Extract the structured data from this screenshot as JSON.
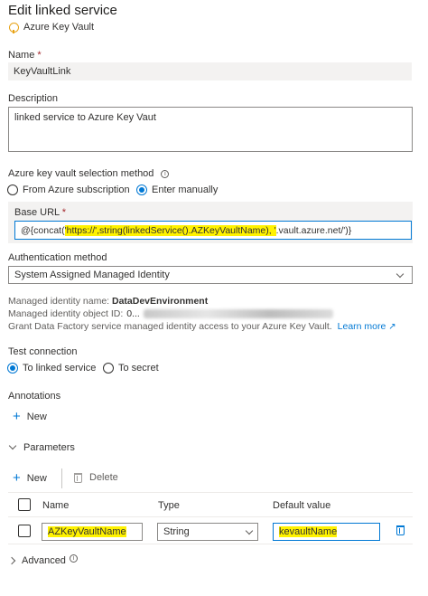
{
  "header": {
    "title": "Edit linked service",
    "subtitle": "Azure Key Vault"
  },
  "name": {
    "label": "Name",
    "required": "*",
    "value": "KeyVaultLink"
  },
  "description": {
    "label": "Description",
    "value": "linked service to Azure Key Vaut"
  },
  "selection_method": {
    "label": "Azure key vault selection method",
    "options": [
      "From Azure subscription",
      "Enter manually"
    ],
    "selected": "Enter manually"
  },
  "base_url": {
    "label": "Base URL",
    "required": "*",
    "value_prefix": "@{concat(",
    "value_highlight": "'https://',string(linkedService().AZKeyVaultName), '",
    "value_suffix": ".vault.azure.net/')}"
  },
  "auth": {
    "label": "Authentication method",
    "value": "System Assigned Managed Identity"
  },
  "managed_identity": {
    "name_label": "Managed identity name:",
    "name_value": "DataDevEnvironment",
    "object_id_label": "Managed identity object ID:",
    "object_id_visible": "0...",
    "grant_text": "Grant Data Factory service managed identity access to your Azure Key Vault.",
    "learn_more": "Learn more"
  },
  "test_connection": {
    "label": "Test connection",
    "options": [
      "To linked service",
      "To secret"
    ],
    "selected": "To linked service"
  },
  "annotations": {
    "label": "Annotations",
    "new_label": "New"
  },
  "parameters": {
    "label": "Parameters",
    "new_label": "New",
    "delete_label": "Delete",
    "columns": [
      "Name",
      "Type",
      "Default value"
    ],
    "rows": [
      {
        "name": "AZKeyVaultName",
        "type": "String",
        "default": "kevaultName"
      }
    ]
  },
  "advanced": {
    "label": "Advanced"
  },
  "colors": {
    "accent": "#0078d4",
    "highlight": "#fff200",
    "required": "#a4262c"
  }
}
